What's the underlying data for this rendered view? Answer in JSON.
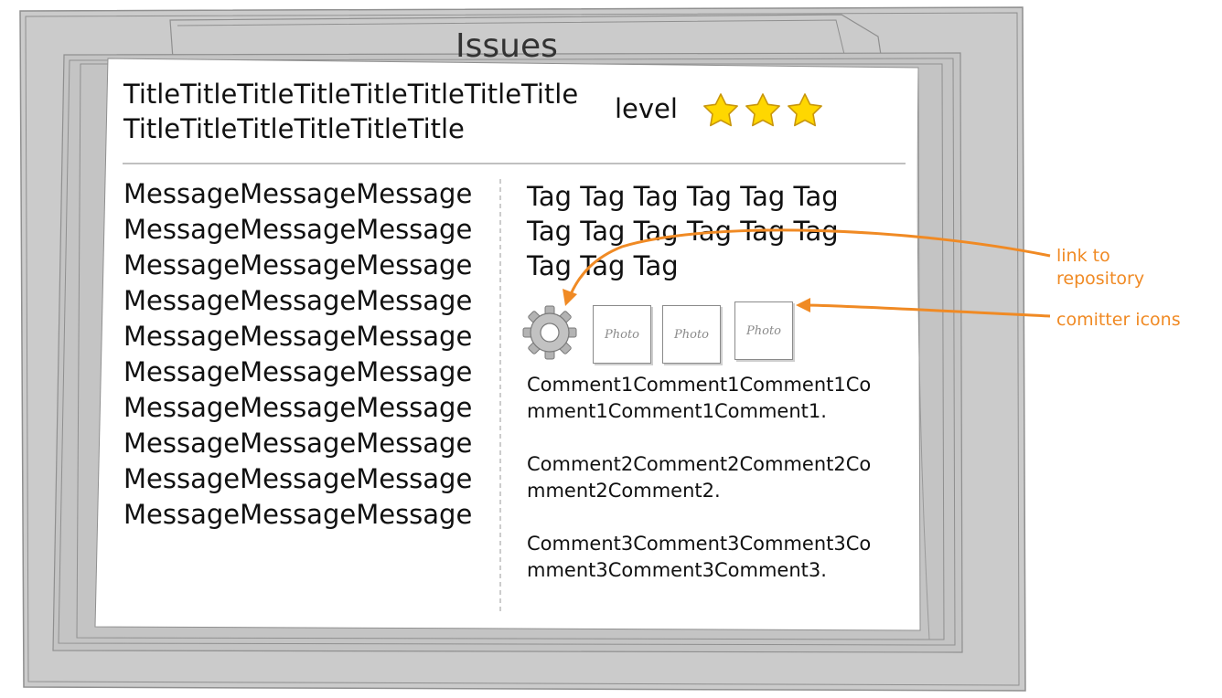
{
  "window": {
    "title": "Issues"
  },
  "issue": {
    "title": "TitleTitleTitleTitleTitleTitleTitleTitleTitleTitleTitleTitleTitleTitle",
    "level_label": "level",
    "level_stars": 3,
    "level_max_stars": 3,
    "message": "MessageMessageMessageMessageMessageMessageMessageMessageMessageMessageMessageMessageMessageMessageMessageMessageMessageMessageMessageMessageMessageMessageMessageMessageMessageMessageMessageMessageMessageMessage",
    "tags": "Tag Tag Tag Tag Tag Tag Tag Tag Tag Tag Tag Tag Tag Tag Tag"
  },
  "repository_link": {
    "icon": "gear-icon"
  },
  "committers": [
    {
      "label": "Photo"
    },
    {
      "label": "Photo"
    },
    {
      "label": "Photo"
    }
  ],
  "comments": [
    {
      "text": "Comment1Comment1Comment1Comment1Comment1Comment1."
    },
    {
      "text": "Comment2Comment2Comment2Comment2Comment2."
    },
    {
      "text": "Comment3Comment3Comment3Comment3Comment3Comment3."
    }
  ],
  "annotations": {
    "repository": "link to\nrepository",
    "committers": "comitter icons"
  },
  "colors": {
    "frame": "#cbcbcb",
    "frame_stroke": "#8f8f8f",
    "annotation": "#f08a24",
    "star": "#ffd700"
  }
}
